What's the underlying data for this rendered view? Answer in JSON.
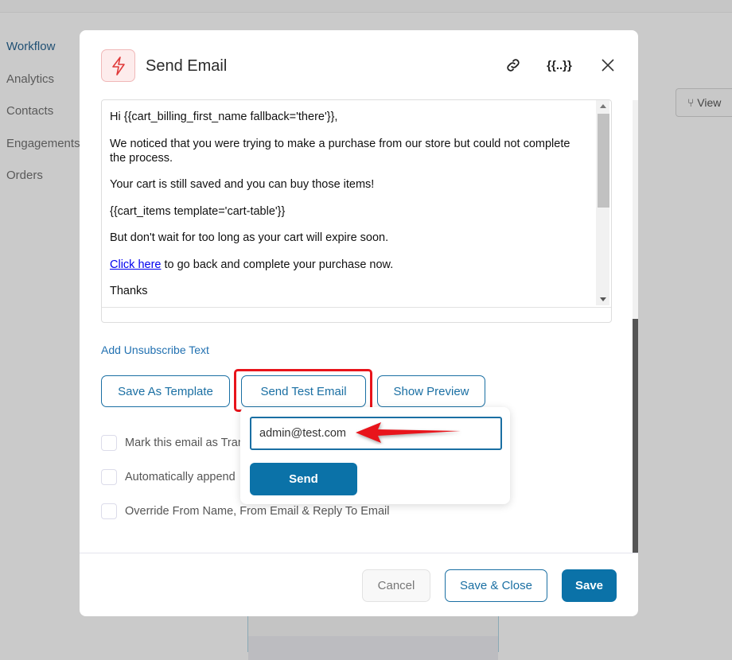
{
  "sidebar": {
    "items": [
      {
        "label": "Workflow"
      },
      {
        "label": "Analytics"
      },
      {
        "label": "Contacts"
      },
      {
        "label": "Engagements"
      },
      {
        "label": "Orders"
      }
    ]
  },
  "background": {
    "view_button": "View"
  },
  "modal": {
    "title": "Send Email",
    "icons": {
      "header": "lightning-icon",
      "link": "link-icon",
      "merge_tags": "merge-tags-icon",
      "close": "close-icon"
    },
    "merge_tags_glyph": "{{..}}",
    "editor": {
      "greeting": "Hi {{cart_billing_first_name fallback='there'}},",
      "p1": "We noticed that you were trying to make a purchase from our store but could not complete the process.",
      "p2": "Your cart is still saved and you can buy those items!",
      "p3": "{{cart_items template='cart-table'}}",
      "p4": "But don't wait for too long as your cart will expire soon.",
      "link_text": "Click here",
      "p5_rest": " to go back and complete your purchase now.",
      "p6": "Thanks"
    },
    "add_unsubscribe": "Add Unsubscribe Text",
    "buttons": {
      "save_template": "Save As Template",
      "send_test": "Send Test Email",
      "show_preview": "Show Preview"
    },
    "checkboxes": [
      {
        "label": "Mark this email as Tran",
        "checked": false
      },
      {
        "label": "Automatically append",
        "checked": false
      },
      {
        "label": "Override From Name, From Email & Reply To Email",
        "checked": false
      }
    ],
    "test_popover": {
      "email_value": "admin@test.com",
      "send_label": "Send"
    },
    "footer": {
      "cancel": "Cancel",
      "save_close": "Save & Close",
      "save": "Save"
    }
  },
  "colors": {
    "primary": "#0b72a8",
    "highlight": "#e8141b",
    "icon_red": "#e03a3a"
  }
}
